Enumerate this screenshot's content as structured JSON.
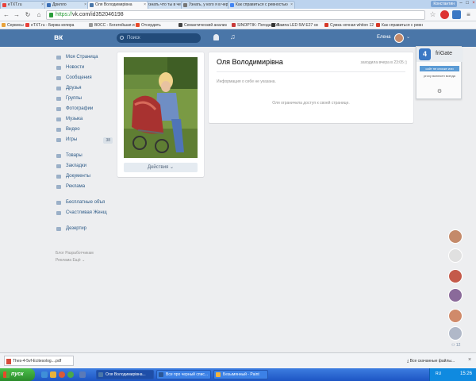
{
  "browser": {
    "tabs": [
      {
        "label": "eTXT.ru",
        "color": "#e8423b"
      },
      {
        "label": "Дрилло",
        "color": "#3b6fb6"
      },
      {
        "label": "Оля Володимирівна",
        "color": "#4a76a8"
      },
      {
        "label": "как узнать что ты в черном",
        "color": "#4285f4"
      },
      {
        "label": "Узнать, у кого я в черном сп",
        "color": "#777777"
      },
      {
        "label": "Как справиться с ревностью",
        "color": "#4285f4"
      }
    ],
    "user_badge": "Константин",
    "url_scheme": "https://",
    "url_rest": "vk.com/id352046198",
    "bookmarks": [
      {
        "label": "Сервисы",
        "color": "#e8a23b"
      },
      {
        "label": "eTXT.ru - Биржа копира",
        "color": "#e8423b"
      },
      {
        "label": "ВОСС - Богатейшая и",
        "color": "#999999"
      },
      {
        "label": "Отсердить",
        "color": "#e84a2a"
      },
      {
        "label": "Семантический анализ",
        "color": "#444444"
      },
      {
        "label": "SINOPTIK: Погода в Ук",
        "color": "#c83a3a"
      },
      {
        "label": "Лампа LED 5W E27 св",
        "color": "#333333"
      },
      {
        "label": "Сумка ночная whiton 12",
        "color": "#d63a2a"
      },
      {
        "label": "Как справиться с ревн",
        "color": "#d63a2a"
      }
    ]
  },
  "vk": {
    "logo": "вк",
    "search_placeholder": "Поиск",
    "user_name": "Елена",
    "menu": [
      {
        "label": "Моя Страница",
        "sep_before": false
      },
      {
        "label": "Новости",
        "sep_before": false
      },
      {
        "label": "Сообщения",
        "sep_before": false
      },
      {
        "label": "Друзья",
        "sep_before": false
      },
      {
        "label": "Группы",
        "sep_before": false
      },
      {
        "label": "Фотографии",
        "sep_before": false
      },
      {
        "label": "Музыка",
        "sep_before": false
      },
      {
        "label": "Видео",
        "sep_before": false
      },
      {
        "label": "Игры",
        "sep_before": false,
        "count": "38"
      },
      {
        "label": "Товары",
        "sep_before": true
      },
      {
        "label": "Закладки",
        "sep_before": false
      },
      {
        "label": "Документы",
        "sep_before": false
      },
      {
        "label": "Реклама",
        "sep_before": false
      },
      {
        "label": "Бесплатные объя",
        "sep_before": true
      },
      {
        "label": "Счастливая Женщ",
        "sep_before": false
      },
      {
        "label": "Дезертир",
        "sep_before": true
      }
    ],
    "footer_line1": "Блог   Разработчикам",
    "footer_line2": "Реклама   Ещё ⌄",
    "actions_label": "Действия ⌄",
    "profile_name": "Оля Володимирівна",
    "last_seen": "заходила вчера в 23:05",
    "no_info": "Информация о себе не указана.",
    "restricted": "Оля ограничила доступ к своей странице."
  },
  "frigate": {
    "title": "friGate",
    "status": "сайт не списке или",
    "info": "proxy включен всегда",
    "logo": "4"
  },
  "chats": [
    "#c48a6a",
    "#e0e0e0",
    "#c45a4a",
    "#8a6a9a",
    "#d08a6a",
    "#b0b8c8"
  ],
  "chat_count": "12",
  "downloads": {
    "file": "Thes-4-5vf-Ecitesolog....pdf",
    "show_all": "Все скачанные файлы..."
  },
  "taskbar": {
    "start": "пуск",
    "tasks": [
      {
        "label": "Оля Володимирівна...",
        "color": "#4a76a8",
        "active": true
      },
      {
        "label": "Все про черный спис...",
        "color": "#2b5797",
        "active": false
      },
      {
        "label": "Безымянный - Paint",
        "color": "#f2b33d",
        "active": false
      }
    ],
    "lang": "RU",
    "clock": "15:26"
  }
}
